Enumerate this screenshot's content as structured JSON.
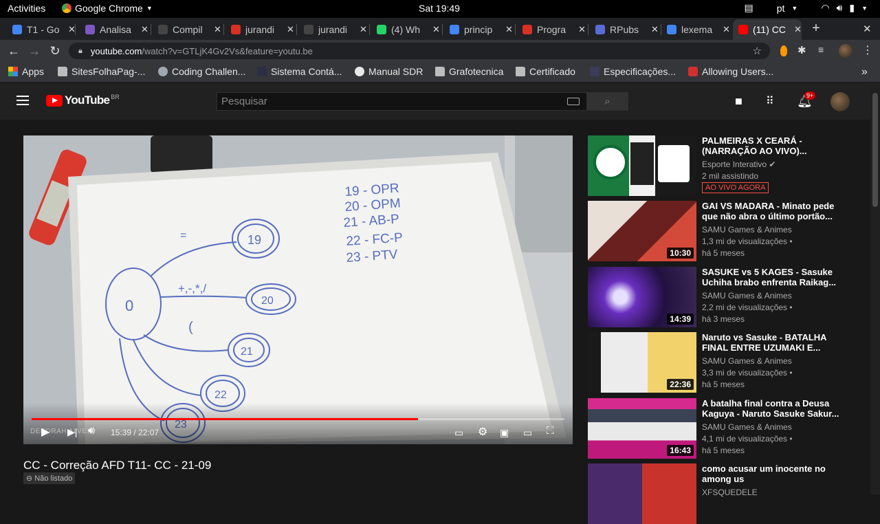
{
  "system": {
    "activities": "Activities",
    "app": "Google Chrome",
    "clock": "Sat 19:49",
    "lang": "pt"
  },
  "tabs": [
    {
      "label": "T1 - Go",
      "color": "#4285f4"
    },
    {
      "label": "Analisa",
      "color": "#7e57c2"
    },
    {
      "label": "Compil",
      "color": "#444444"
    },
    {
      "label": "jurandi",
      "color": "#d93025"
    },
    {
      "label": "jurandi",
      "color": "#444444"
    },
    {
      "label": "(4) Wh",
      "color": "#25d366"
    },
    {
      "label": "princip",
      "color": "#4285f4"
    },
    {
      "label": "Progra",
      "color": "#d93025"
    },
    {
      "label": "RPubs",
      "color": "#5b6bd6"
    },
    {
      "label": "lexema",
      "color": "#4285f4"
    },
    {
      "label": "(11) CC",
      "color": "#ff0000"
    }
  ],
  "address": {
    "domain": "youtube.com",
    "path": "/watch?v=GTLjK4Gv2Vs&feature=youtu.be"
  },
  "bookmarks": [
    {
      "label": "Apps"
    },
    {
      "label": "SitesFolhaPag-..."
    },
    {
      "label": "Coding Challen..."
    },
    {
      "label": "Sistema Contá..."
    },
    {
      "label": "Manual SDR"
    },
    {
      "label": "Grafotecnica"
    },
    {
      "label": "Certificado"
    },
    {
      "label": "Especificações..."
    },
    {
      "label": "Allowing Users..."
    }
  ],
  "youtube": {
    "logo": "YouTube",
    "country": "BR",
    "search_placeholder": "Pesquisar",
    "notifications": "9+"
  },
  "player": {
    "time": "15:39 / 22:07",
    "progress": 0.725,
    "watermark": "DEBORAH ALVES"
  },
  "video": {
    "title": "CC - Correção AFD T11- CC - 21-09",
    "visibility": "Não listado"
  },
  "recommendations": [
    {
      "title": "PALMEIRAS X CEARÁ - (NARRAÇÃO AO VIVO)...",
      "channel": "Esporte Interativo",
      "views": "2 mil assistindo",
      "age": "",
      "live": "AO VIVO AGORA",
      "duration": ""
    },
    {
      "title": "GAI VS MADARA - Minato pede que não abra o último portão...",
      "channel": "SAMU Games & Animes",
      "views": "1,3 mi de visualizações •",
      "age": "há 5 meses",
      "duration": "10:30"
    },
    {
      "title": "SASUKE vs 5 KAGES - Sasuke Uchiha brabo enfrenta Raikag...",
      "channel": "SAMU Games & Animes",
      "views": "2,2 mi de visualizações •",
      "age": "há 3 meses",
      "duration": "14:39"
    },
    {
      "title": "Naruto vs Sasuke - BATALHA FINAL ENTRE UZUMAKI E...",
      "channel": "SAMU Games & Animes",
      "views": "3,3 mi de visualizações •",
      "age": "há 5 meses",
      "duration": "22:36"
    },
    {
      "title": "A batalha final contra a Deusa Kaguya - Naruto Sasuke Sakur...",
      "channel": "SAMU Games & Animes",
      "views": "4,1 mi de visualizações •",
      "age": "há 5 meses",
      "duration": "16:43"
    },
    {
      "title": "como acusar um inocente no among us",
      "channel": "XFSQUEDELE",
      "views": "",
      "age": "",
      "duration": ""
    }
  ],
  "whiteboard": {
    "states": [
      "0",
      "19",
      "20",
      "21",
      "22",
      "23"
    ],
    "legend": [
      "19 - OPR",
      "20 - OPM",
      "21 - AB-P",
      "22 - FC-P",
      "23 - PTV"
    ],
    "edge_labels": [
      "=",
      "+,-,*,/",
      "("
    ]
  }
}
